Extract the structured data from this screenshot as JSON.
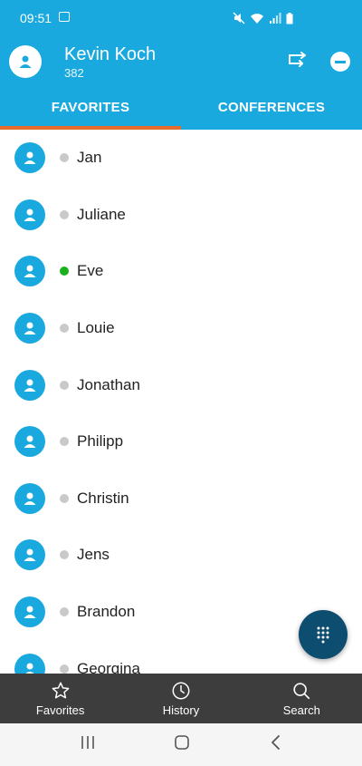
{
  "status_bar": {
    "time": "09:51"
  },
  "header": {
    "user_name": "Kevin Koch",
    "extension": "382"
  },
  "tabs": [
    {
      "label": "FAVORITES",
      "active": true
    },
    {
      "label": "CONFERENCES",
      "active": false
    }
  ],
  "contacts": [
    {
      "name": "Jan",
      "status": "offline"
    },
    {
      "name": "Juliane",
      "status": "offline"
    },
    {
      "name": "Eve",
      "status": "online"
    },
    {
      "name": "Louie",
      "status": "offline"
    },
    {
      "name": "Jonathan",
      "status": "offline"
    },
    {
      "name": "Philipp",
      "status": "offline"
    },
    {
      "name": "Christin",
      "status": "offline"
    },
    {
      "name": "Jens",
      "status": "offline"
    },
    {
      "name": "Brandon",
      "status": "offline"
    },
    {
      "name": "Georgina",
      "status": "offline"
    }
  ],
  "bottom_nav": [
    {
      "label": "Favorites",
      "icon": "star-icon"
    },
    {
      "label": "History",
      "icon": "clock-icon"
    },
    {
      "label": "Search",
      "icon": "search-icon"
    }
  ],
  "colors": {
    "primary": "#1aa9df",
    "tab_indicator": "#e86b2e",
    "fab": "#0d4d6f",
    "online": "#1cb11c",
    "offline": "#c9c9c9",
    "bottom_nav_bg": "#3d3d3d"
  }
}
